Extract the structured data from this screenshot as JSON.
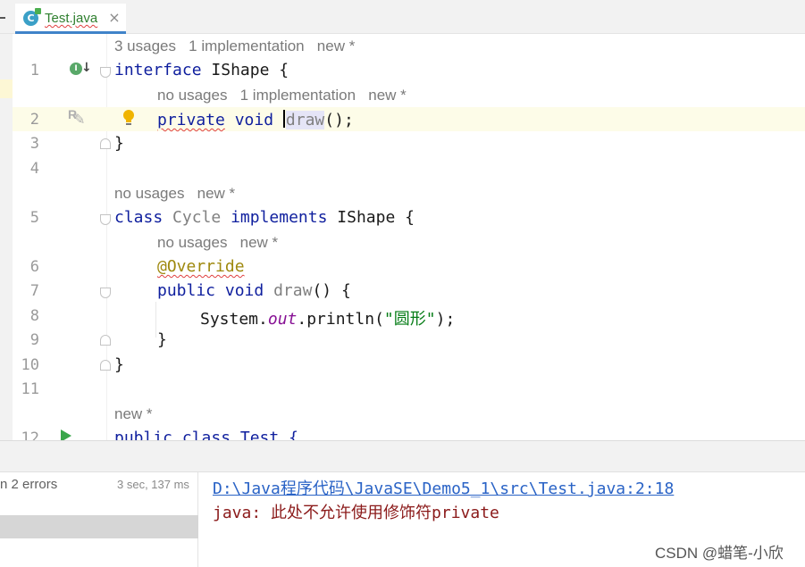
{
  "tab": {
    "filename": "Test.java",
    "icon": "java-class-icon",
    "close_icon": "close-icon"
  },
  "editor": {
    "line_numbers": [
      "1",
      "2",
      "3",
      "4",
      "5",
      "6",
      "7",
      "8",
      "9",
      "10",
      "11",
      "12"
    ],
    "hints": {
      "h1": "3 usages   1 implementation   new *",
      "h2": "no usages   1 implementation   new *",
      "h3": "no usages   new *",
      "h4": "no usages   new *",
      "h5": "new *"
    },
    "tokens": {
      "interface": "interface",
      "ishape": "IShape",
      "open_brace": " {",
      "private": "private",
      "void": "void",
      "draw": "draw",
      "call_end": "();",
      "close_brace": "}",
      "class": "class",
      "cycle": "Cycle",
      "implements": "implements",
      "override": "@Override",
      "public": "public",
      "draw_sig": "() {",
      "system": "System.",
      "out": "out",
      "println": ".println(",
      "string": "\"圆形\"",
      "println_end": ");",
      "inner_close": "}",
      "line12": "public class Test {"
    }
  },
  "build": {
    "summary": "n 2 errors",
    "time": "3 sec, 137 ms",
    "error_link": "D:\\Java程序代码\\JavaSE\\Demo5_1\\src\\Test.java:2:18",
    "error_message": "java: 此处不允许使用修饰符private"
  },
  "watermark": "CSDN @蜡笔-小欣"
}
